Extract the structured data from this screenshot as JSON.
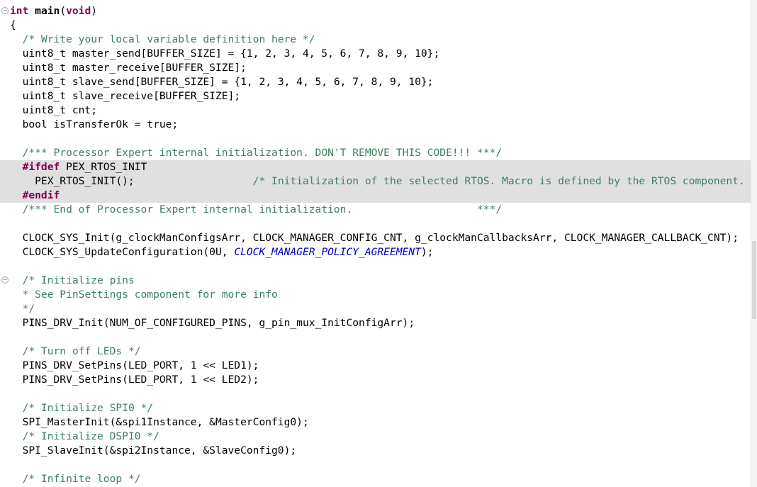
{
  "lines": [
    {
      "t": "",
      "parts": [
        [
          "kw",
          "int"
        ],
        [
          "",
          ""
        ],
        [
          "",
          " "
        ],
        [
          "fn",
          "main"
        ],
        [
          "",
          "("
        ],
        [
          "kw",
          "void"
        ],
        [
          "",
          ")"
        ]
      ],
      "fold": true
    },
    {
      "parts": [
        [
          "",
          "{"
        ]
      ]
    },
    {
      "parts": [
        [
          "",
          "  "
        ],
        [
          "cm",
          "/* Write your local variable definition here */"
        ]
      ]
    },
    {
      "parts": [
        [
          "",
          "  uint8_t master_send[BUFFER_SIZE] = {1, 2, 3, 4, 5, 6, 7, 8, 9, 10};"
        ]
      ]
    },
    {
      "parts": [
        [
          "",
          "  uint8_t master_receive[BUFFER_SIZE];"
        ]
      ]
    },
    {
      "parts": [
        [
          "",
          "  uint8_t slave_send[BUFFER_SIZE] = {1, 2, 3, 4, 5, 6, 7, 8, 9, 10};"
        ]
      ]
    },
    {
      "parts": [
        [
          "",
          "  uint8_t slave_receive[BUFFER_SIZE];"
        ]
      ]
    },
    {
      "parts": [
        [
          "",
          "  uint8_t cnt;"
        ]
      ]
    },
    {
      "parts": [
        [
          "",
          "  bool isTransferOk = true;"
        ]
      ]
    },
    {
      "parts": [
        [
          "",
          ""
        ]
      ]
    },
    {
      "parts": [
        [
          "",
          "  "
        ],
        [
          "cm",
          "/*** Processor Expert internal initialization. DON'T REMOVE THIS CODE!!! ***/"
        ]
      ]
    },
    {
      "hl": true,
      "parts": [
        [
          "",
          "  "
        ],
        [
          "pp",
          "#ifdef"
        ],
        [
          "",
          " PEX_RTOS_INIT"
        ]
      ]
    },
    {
      "hl": true,
      "parts": [
        [
          "",
          "    PEX_RTOS_INIT();                   "
        ],
        [
          "cm",
          "/* Initialization of the selected RTOS. Macro is defined by the RTOS component. */"
        ]
      ]
    },
    {
      "hl": true,
      "parts": [
        [
          "",
          "  "
        ],
        [
          "pp",
          "#endif"
        ]
      ]
    },
    {
      "parts": [
        [
          "",
          "  "
        ],
        [
          "cm",
          "/*** End of Processor Expert internal initialization.                    ***/"
        ]
      ]
    },
    {
      "parts": [
        [
          "",
          ""
        ]
      ]
    },
    {
      "parts": [
        [
          "",
          "  CLOCK_SYS_Init(g_clockManConfigsArr, CLOCK_MANAGER_CONFIG_CNT, g_clockManCallbacksArr, CLOCK_MANAGER_CALLBACK_CNT);"
        ]
      ]
    },
    {
      "parts": [
        [
          "",
          "  CLOCK_SYS_UpdateConfiguration(0U, "
        ],
        [
          "en",
          "CLOCK_MANAGER_POLICY_AGREEMENT"
        ],
        [
          "",
          ");"
        ]
      ]
    },
    {
      "parts": [
        [
          "",
          ""
        ]
      ]
    },
    {
      "fold": true,
      "parts": [
        [
          "",
          "  "
        ],
        [
          "cm",
          "/* Initialize pins"
        ]
      ]
    },
    {
      "parts": [
        [
          "",
          "  "
        ],
        [
          "cm",
          "* See PinSettings component for more info"
        ]
      ]
    },
    {
      "parts": [
        [
          "",
          "  "
        ],
        [
          "cm",
          "*/"
        ]
      ]
    },
    {
      "parts": [
        [
          "",
          "  PINS_DRV_Init(NUM_OF_CONFIGURED_PINS, g_pin_mux_InitConfigArr);"
        ]
      ]
    },
    {
      "parts": [
        [
          "",
          ""
        ]
      ]
    },
    {
      "parts": [
        [
          "",
          "  "
        ],
        [
          "cm",
          "/* Turn off LEDs */"
        ]
      ]
    },
    {
      "parts": [
        [
          "",
          "  PINS_DRV_SetPins(LED_PORT, 1 << LED1);"
        ]
      ]
    },
    {
      "parts": [
        [
          "",
          "  PINS_DRV_SetPins(LED_PORT, 1 << LED2);"
        ]
      ]
    },
    {
      "parts": [
        [
          "",
          ""
        ]
      ]
    },
    {
      "parts": [
        [
          "",
          "  "
        ],
        [
          "cm",
          "/* Initialize SPI0 */"
        ]
      ]
    },
    {
      "parts": [
        [
          "",
          "  SPI_MasterInit(&spi1Instance, &MasterConfig0);"
        ]
      ]
    },
    {
      "parts": [
        [
          "",
          "  "
        ],
        [
          "cm",
          "/* Initialize DSPI0 */"
        ]
      ]
    },
    {
      "parts": [
        [
          "",
          "  SPI_SlaveInit(&spi2Instance, &SlaveConfig0);"
        ]
      ]
    },
    {
      "parts": [
        [
          "",
          ""
        ]
      ]
    },
    {
      "parts": [
        [
          "",
          "  "
        ],
        [
          "cm",
          "/* Infinite loop */"
        ]
      ]
    }
  ],
  "icons": {
    "fold": "fold-collapse-icon"
  }
}
